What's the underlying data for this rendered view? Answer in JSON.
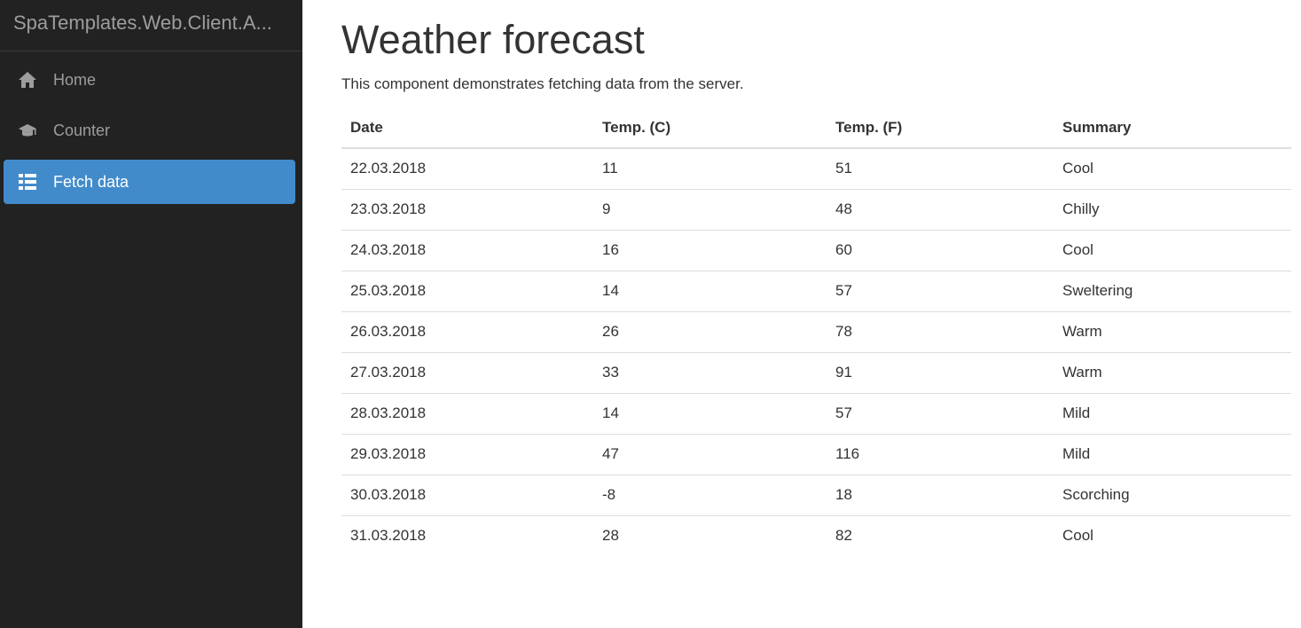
{
  "app": {
    "brand": "SpaTemplates.Web.Client.A..."
  },
  "sidebar": {
    "items": [
      {
        "label": "Home",
        "icon": "home-icon",
        "active": false
      },
      {
        "label": "Counter",
        "icon": "graduation-cap-icon",
        "active": false
      },
      {
        "label": "Fetch data",
        "icon": "list-icon",
        "active": true
      }
    ]
  },
  "page": {
    "title": "Weather forecast",
    "description": "This component demonstrates fetching data from the server."
  },
  "table": {
    "headers": [
      "Date",
      "Temp. (C)",
      "Temp. (F)",
      "Summary"
    ],
    "rows": [
      [
        "22.03.2018",
        "11",
        "51",
        "Cool"
      ],
      [
        "23.03.2018",
        "9",
        "48",
        "Chilly"
      ],
      [
        "24.03.2018",
        "16",
        "60",
        "Cool"
      ],
      [
        "25.03.2018",
        "14",
        "57",
        "Sweltering"
      ],
      [
        "26.03.2018",
        "26",
        "78",
        "Warm"
      ],
      [
        "27.03.2018",
        "33",
        "91",
        "Warm"
      ],
      [
        "28.03.2018",
        "14",
        "57",
        "Mild"
      ],
      [
        "29.03.2018",
        "47",
        "116",
        "Mild"
      ],
      [
        "30.03.2018",
        "-8",
        "18",
        "Scorching"
      ],
      [
        "31.03.2018",
        "28",
        "82",
        "Cool"
      ]
    ]
  },
  "colors": {
    "sidebar_bg": "#222222",
    "active_bg": "#428bca",
    "nav_text": "#9d9d9d"
  }
}
